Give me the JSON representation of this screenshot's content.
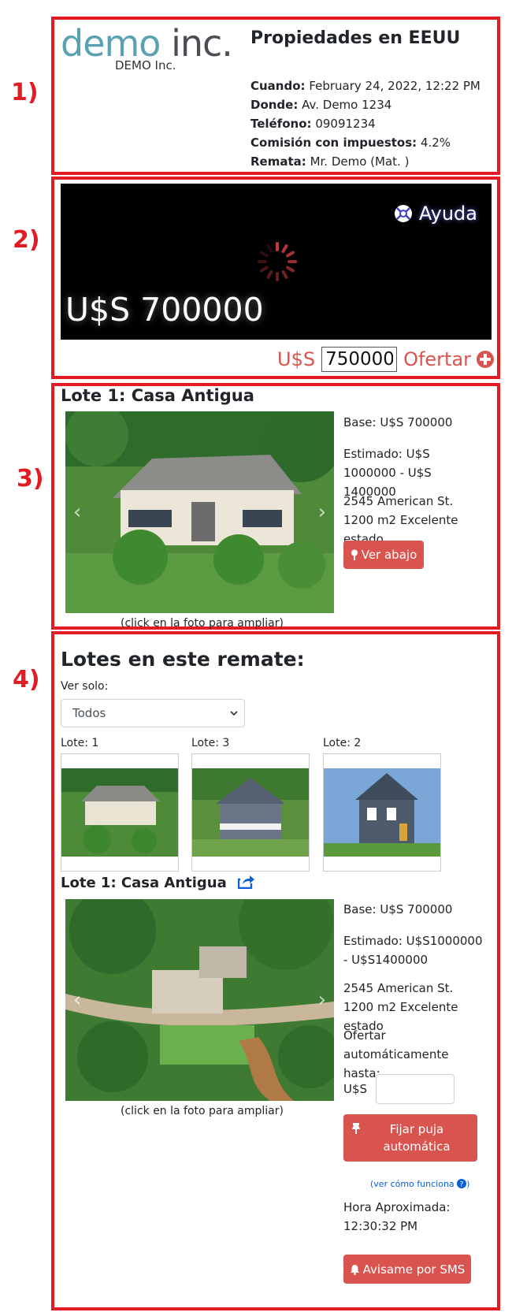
{
  "section_numbers": [
    "1)",
    "2)",
    "3)",
    "4)"
  ],
  "header": {
    "logo_word_1": "demo",
    "logo_word_2": "inc.",
    "logo_sub": "DEMO Inc.",
    "title": "Propiedades en EEUU",
    "info": [
      {
        "label": "Cuando:",
        "value": "February 24, 2022, 12:22 PM"
      },
      {
        "label": "Donde:",
        "value": "Av. Demo 1234"
      },
      {
        "label": "Teléfono:",
        "value": "09091234"
      },
      {
        "label": "Comisión con impuestos:",
        "value": "4.2%"
      },
      {
        "label": "Remata:",
        "value": "Mr. Demo (Mat. )"
      }
    ]
  },
  "live": {
    "help_label": "Ayuda",
    "current_price": "U$S 700000",
    "currency": "U$S",
    "bid_value": "750000",
    "bid_label": "Ofertar"
  },
  "current_lot": {
    "title": "Lote 1: Casa Antigua",
    "base": "Base: U$S 700000",
    "estimated": "Estimado: U$S 1000000 - U$S 1400000",
    "description": "2545 American St. 1200 m2 Excelente estado",
    "view_button": "Ver abajo",
    "caption": "(click en la foto para ampliar)"
  },
  "lots": {
    "heading": "Lotes en este remate:",
    "filter_label": "Ver solo:",
    "filter_selected": "Todos",
    "thumbs": [
      {
        "label": "Lote: 1"
      },
      {
        "label": "Lote: 3"
      },
      {
        "label": "Lote: 2"
      }
    ],
    "detail": {
      "title": "Lote 1: Casa Antigua",
      "base": "Base: U$S 700000",
      "estimated": "Estimado: U$S1000000 - U$S1400000",
      "description": "2545 American St. 1200 m2 Excelente estado",
      "auto_label": "Ofertar automáticamente hasta:",
      "auto_currency": "U$S",
      "auto_value": "",
      "fix_button": "Fijar puja automática",
      "how_link": "(ver cómo funciona",
      "time_label": "Hora Aproximada:",
      "time_value": "12:30:32 PM",
      "sms_button": "Avisame por SMS",
      "caption": "(click en la foto para ampliar)"
    }
  },
  "colors": {
    "accent_red": "#e31b23",
    "button_red": "#d9534f",
    "logo_teal": "#5aa2b1",
    "link_blue": "#0b5ed7"
  }
}
